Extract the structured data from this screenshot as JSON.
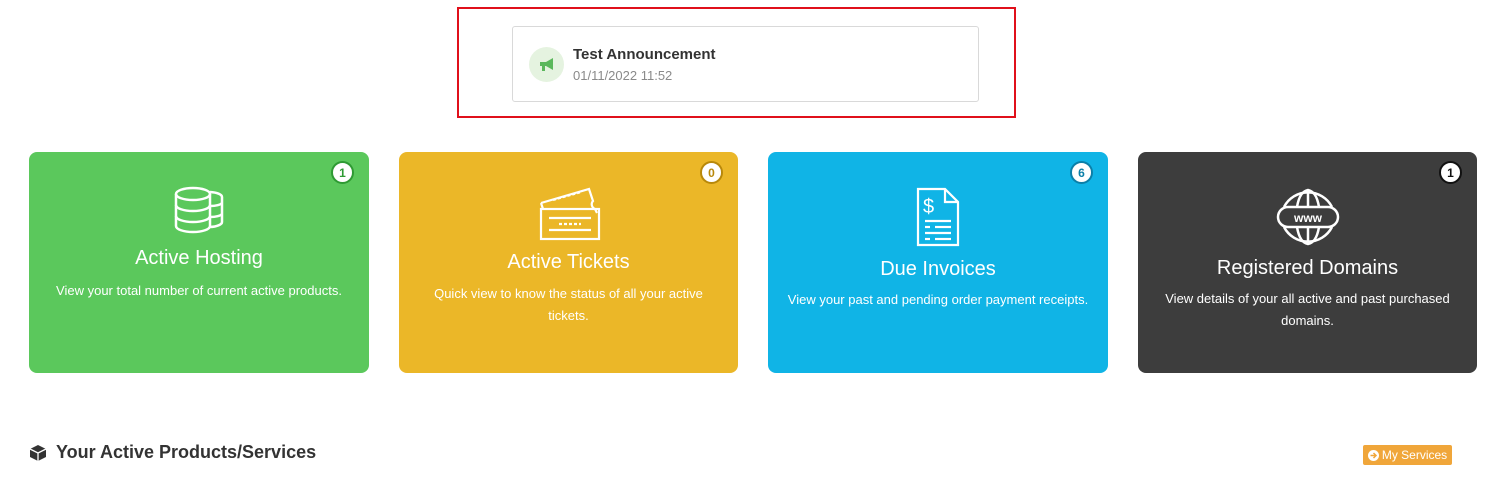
{
  "announcement": {
    "title": "Test Announcement",
    "date": "01/11/2022 11:52",
    "icon": "megaphone-icon"
  },
  "cards": [
    {
      "title": "Active Hosting",
      "count": "1",
      "description": "View your total number of current active products.",
      "icon": "database-icon",
      "color": "#5bc85c"
    },
    {
      "title": "Active Tickets",
      "count": "0",
      "description": "Quick view to know the  status of all your active tickets.",
      "icon": "ticket-icon",
      "color": "#ebb728"
    },
    {
      "title": "Due Invoices",
      "count": "6",
      "description": "View your past and pending order payment receipts.",
      "icon": "invoice-icon",
      "color": "#10b4e6"
    },
    {
      "title": "Registered Domains",
      "count": "1",
      "description": "View details of your all active and past purchased domains.",
      "icon": "www-globe-icon",
      "color": "#3d3d3d"
    }
  ],
  "products_section": {
    "title": "Your Active Products/Services",
    "button_label": "My Services",
    "icon": "cube-icon"
  },
  "colors": {
    "highlight": "#e0101b",
    "button": "#f0a63a"
  }
}
